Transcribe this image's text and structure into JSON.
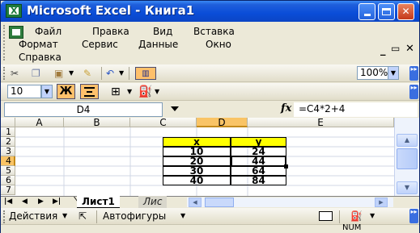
{
  "window": {
    "title": "Microsoft Excel - Книга1"
  },
  "menu": {
    "items": [
      "Файл",
      "Правка",
      "Вид",
      "Вставка",
      "Формат",
      "Сервис",
      "Данные",
      "Окно",
      "Справка"
    ]
  },
  "toolbar": {
    "zoom": "100%",
    "font_size": "10",
    "bold_label": "Ж"
  },
  "formula_bar": {
    "name_box": "D4",
    "fx_label": "fx",
    "formula": "=C4*2+4"
  },
  "grid": {
    "columns": [
      "A",
      "B",
      "C",
      "D",
      "E"
    ],
    "rows": [
      "1",
      "2",
      "3",
      "4",
      "5",
      "6",
      "7"
    ],
    "active_cell": "D4",
    "header_row": [
      "x",
      "y"
    ],
    "data": [
      [
        "10",
        "24"
      ],
      [
        "20",
        "44"
      ],
      [
        "30",
        "64"
      ],
      [
        "40",
        "84"
      ]
    ]
  },
  "sheets": {
    "active": "Лист1",
    "other": "Лис"
  },
  "drawing_toolbar": {
    "actions": "Действия",
    "autoshapes": "Автофигуры"
  },
  "status": {
    "num": "NUM"
  },
  "colors": {
    "title_blue": "#0A4DD8",
    "header_yellow": "#FFFF00",
    "active_header": "#F9C466"
  }
}
